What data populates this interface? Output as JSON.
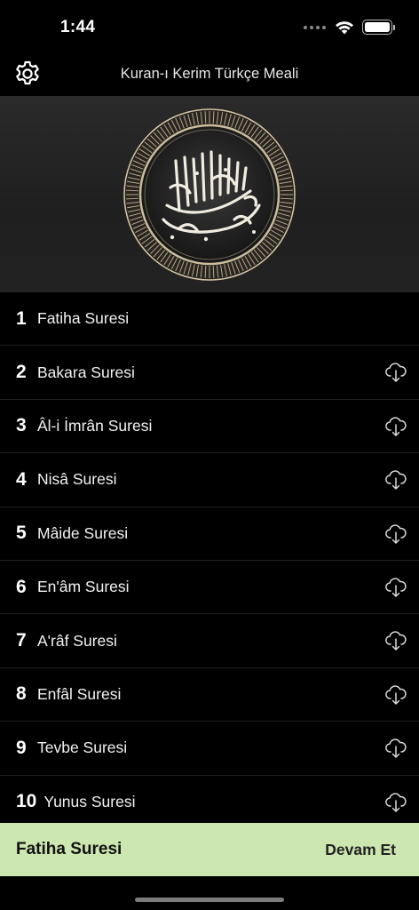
{
  "status_bar": {
    "time": "1:44"
  },
  "nav": {
    "title": "Kuran-ı Kerim Türkçe Meali",
    "settings_icon": "gear-icon"
  },
  "banner": {
    "image": "bismillah-calligraphy-medallion"
  },
  "surahs": [
    {
      "number": "1",
      "name": "Fatiha Suresi",
      "downloadable": false
    },
    {
      "number": "2",
      "name": "Bakara Suresi",
      "downloadable": true
    },
    {
      "number": "3",
      "name": "Âl-i İmrân Suresi",
      "downloadable": true
    },
    {
      "number": "4",
      "name": "Nisâ Suresi",
      "downloadable": true
    },
    {
      "number": "5",
      "name": "Mâide Suresi",
      "downloadable": true
    },
    {
      "number": "6",
      "name": "En'âm Suresi",
      "downloadable": true
    },
    {
      "number": "7",
      "name": "A'râf Suresi",
      "downloadable": true
    },
    {
      "number": "8",
      "name": "Enfâl Suresi",
      "downloadable": true
    },
    {
      "number": "9",
      "name": "Tevbe Suresi",
      "downloadable": true
    },
    {
      "number": "10",
      "name": "Yunus Suresi",
      "downloadable": true
    }
  ],
  "bottom_bar": {
    "title": "Fatiha Suresi",
    "action_label": "Devam Et",
    "color": "#cde7b0"
  }
}
